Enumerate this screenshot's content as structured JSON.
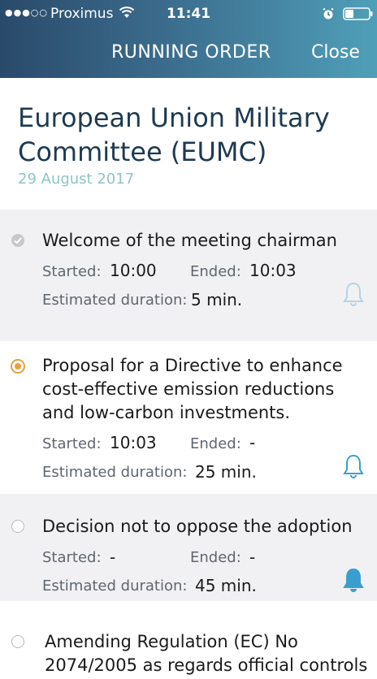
{
  "status_bar": {
    "carrier": "Proximus",
    "time": "11:41"
  },
  "header": {
    "title": "RUNNING ORDER",
    "close_label": "Close"
  },
  "meeting": {
    "title": "European Union Military Committee (EUMC)",
    "date": "29 August 2017"
  },
  "labels": {
    "started": "Started:",
    "ended": "Ended:",
    "estimated": "Estimated duration:"
  },
  "items": [
    {
      "title": "Welcome of the meeting chairman",
      "started": "10:00",
      "ended": "10:03",
      "duration": "5 min.",
      "status": "done",
      "bell": "outline-faded"
    },
    {
      "title": "Proposal for a Directive to enhance cost-effective emission reductions and low-carbon investments.",
      "started": "10:03",
      "ended": "-",
      "duration": "25 min.",
      "status": "current",
      "bell": "outline"
    },
    {
      "title": "Decision not to oppose the adoption",
      "started": "-",
      "ended": "-",
      "duration": "45 min.",
      "status": "upcoming",
      "bell": "filled"
    },
    {
      "title": "Amending Regulation (EC) No 2074/2005 as regards official controls",
      "status": "upcoming"
    }
  ],
  "colors": {
    "header_gradient_start": "#2a4a6a",
    "header_gradient_end": "#4f9fb8",
    "accent_current": "#e8a23c",
    "bell_color": "#3a9fcf",
    "date_color": "#8fc4c6"
  }
}
